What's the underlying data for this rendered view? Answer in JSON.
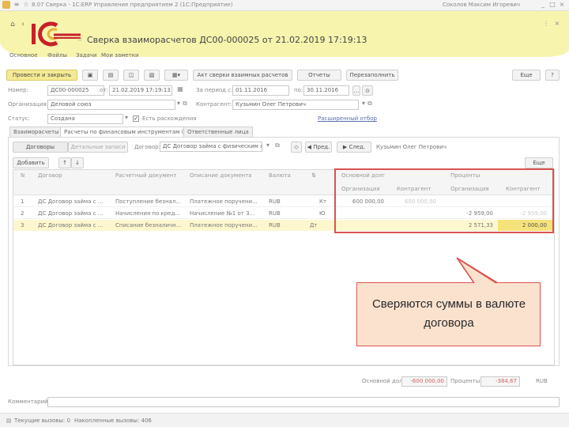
{
  "window": {
    "title": "8.07 Сверка - 1С:ERP Управление предприятием 2 (1С:Предприятие)",
    "user": "Соколов Максим Игоревич"
  },
  "doc": {
    "title": "Сверка взаиморасчетов ДС00-000025 от 21.02.2019 17:19:13",
    "tabs": [
      "Основное",
      "Файлы",
      "Задачи",
      "Мои заметки"
    ]
  },
  "toolbar": {
    "post_close": "Провести и закрыть",
    "settlements": "Акт сверки взаимных расчетов",
    "reports": "Отчеты",
    "recalc": "Перезаполнить",
    "more": "Еще"
  },
  "form": {
    "number_label": "Номер:",
    "number": "ДС00-000025",
    "from_label": "от:",
    "date": "21.02.2019 17:19:13",
    "period_label": "За период с:",
    "period_from": "01.11.2016",
    "period_to_label": "по:",
    "period_to": "30.11.2016",
    "org_label": "Организация:",
    "org": "Деловой союз",
    "counterparty_label": "Контрагент:",
    "counterparty": "Кузьмин Олег Петрович",
    "status_label": "Статус:",
    "status": "Создана",
    "discrepancy_label": "Есть расхождения",
    "advanced_link": "Расширенный отбор"
  },
  "section_tabs": [
    "Взаиморасчеты",
    "Расчеты по финансовым инструментам (1)",
    "Ответственные лица"
  ],
  "subtoolbar": {
    "contracts": "Договоры",
    "detailed": "Детальные записи",
    "contract_label": "Договор:",
    "contract": "ДС Договор займа с физическим лиц",
    "prev": "Пред.",
    "next": "След.",
    "counterparty": "Кузьмин Олег Петрович"
  },
  "table": {
    "add": "Добавить",
    "more": "Еще",
    "headers": {
      "n": "N",
      "contract": "Договор",
      "settlement_doc": "Расчетный документ",
      "doc_desc": "Описание документа",
      "currency": "Валюта",
      "main_debt": "Основной долг",
      "percents": "Проценты",
      "org": "Организация",
      "counterparty": "Контрагент",
      "org2": "Организация",
      "counterparty2": "Контрагент"
    },
    "rows": [
      {
        "n": "1",
        "contract": "ДС Договор займа с ...",
        "doc": "Поступление безнал...",
        "desc": "Платежное поручени...",
        "currency": "RUB",
        "extra": "Кт",
        "debt_org": "600 000,00",
        "debt_cp": "600 000,00",
        "pct_org": "",
        "pct_cp": ""
      },
      {
        "n": "2",
        "contract": "ДС Договор займа с ...",
        "doc": "Начисления по кред...",
        "desc": "Начисление №1 от 3...",
        "currency": "RUB",
        "extra": "Ю",
        "debt_org": "",
        "debt_cp": "",
        "pct_org": "-2 959,00",
        "pct_cp": "-2 959,00"
      },
      {
        "n": "3",
        "contract": "ДС Договор займа с ...",
        "doc": "Списание безналичн...",
        "desc": "Платежное поручени...",
        "currency": "RUB",
        "extra": "Дт",
        "debt_org": "",
        "debt_cp": "",
        "pct_org": "2 571,33",
        "pct_cp": "2 000,00"
      }
    ]
  },
  "callout": {
    "text": "Сверяются суммы в валюте договора"
  },
  "totals": {
    "debt_label": "Основной долг:",
    "debt": "-600 000,00",
    "pct_label": "Проценты:",
    "pct": "-384,67",
    "currency": "RUB"
  },
  "comment_label": "Комментарий:",
  "status_bar": {
    "current": "Текущие вызовы: 0",
    "accumulated": "Накопленные вызовы: 406"
  },
  "colors": {
    "highlight": "#f6f2a0",
    "annotation_red": "#d9534f",
    "callout_bg": "#fbe2cf",
    "selected_row": "#fdf7cf"
  }
}
